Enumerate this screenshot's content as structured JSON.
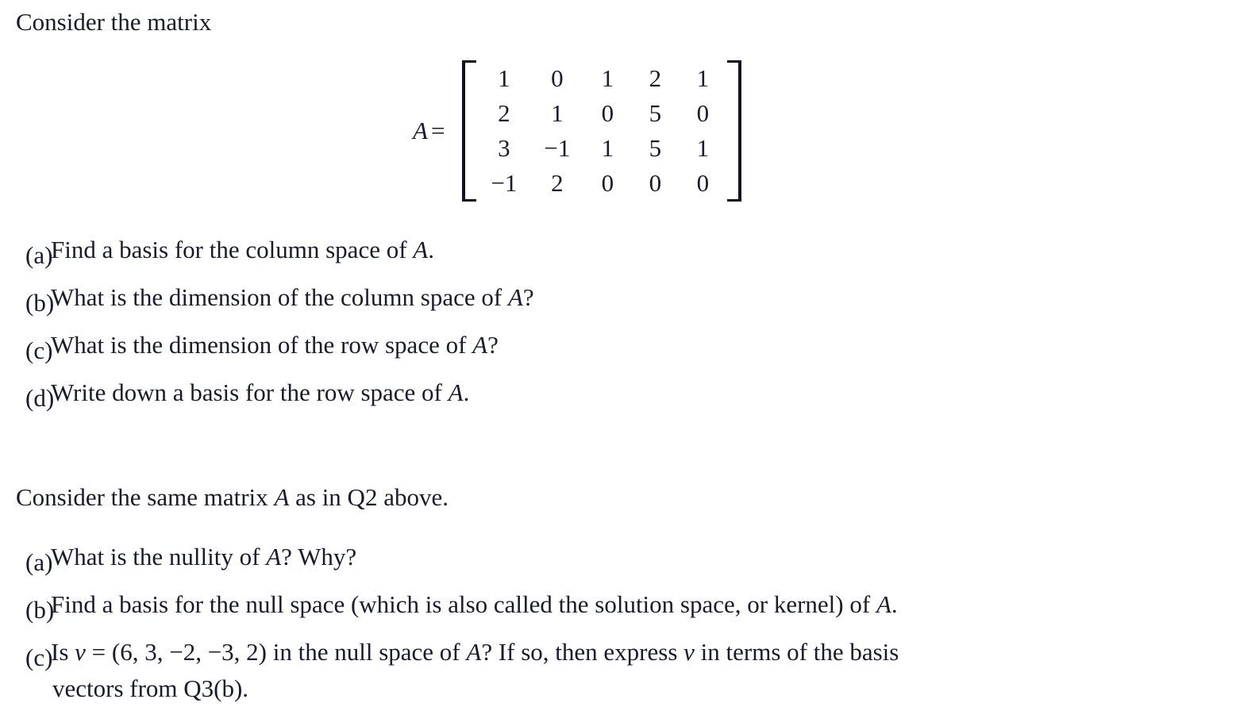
{
  "document": {
    "intro_line": "Consider the matrix",
    "second_intro": {
      "before_var": "Consider the same matrix ",
      "var": "A",
      "after_var": " as in Q2 above."
    }
  },
  "matrix": {
    "name": "A",
    "equals": "=",
    "rows": [
      [
        "1",
        "0",
        "1",
        "2",
        "1"
      ],
      [
        "2",
        "1",
        "0",
        "5",
        "0"
      ],
      [
        "3",
        "−1",
        "1",
        "5",
        "1"
      ],
      [
        "−1",
        "2",
        "0",
        "0",
        "0"
      ]
    ]
  },
  "question_two": {
    "items": [
      {
        "label": "(a)",
        "lines": [
          "Find a basis for the column space of A."
        ]
      },
      {
        "label": "(b)",
        "lines": [
          "What is the dimension of the column space of A?"
        ]
      },
      {
        "label": "(c)",
        "lines": [
          "What is the dimension of the row space of A?"
        ]
      },
      {
        "label": "(d)",
        "lines": [
          "Write down a basis for the row space of A."
        ]
      }
    ]
  },
  "question_three": {
    "items": [
      {
        "label": "(a)",
        "lines": [
          "What is the nullity of A?  Why?"
        ]
      },
      {
        "label": "(b)",
        "lines": [
          "Find a basis for the null space (which is also called the solution space, or kernel) of A."
        ]
      },
      {
        "label": "(c)",
        "lines": [
          "Is v = (6, 3, −2, −3, 2) in the null space of A?  If so, then express v in terms of the basis",
          "vectors from Q3(b)."
        ]
      }
    ]
  },
  "colors": {
    "text": "#1a1a2e",
    "background": "#ffffff",
    "bracket": "#111122"
  }
}
